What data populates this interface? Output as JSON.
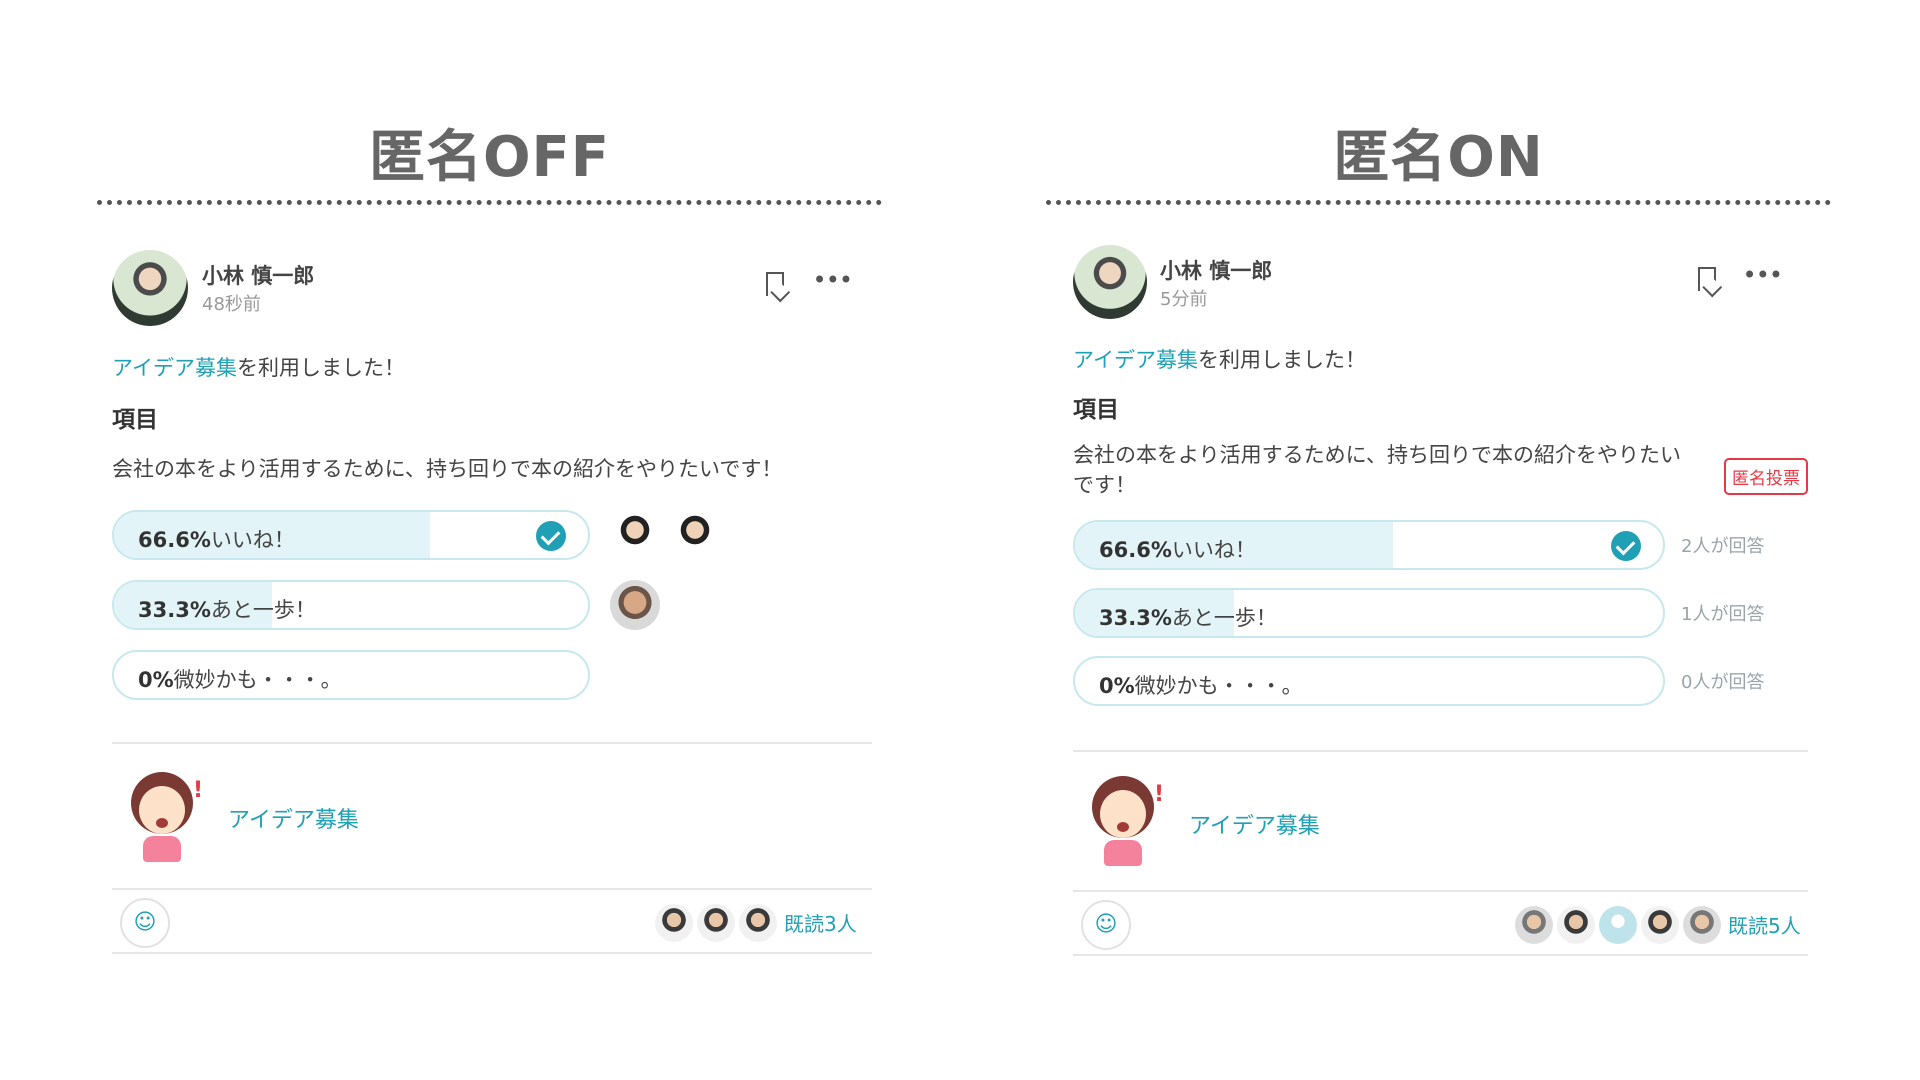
{
  "panels": [
    {
      "title": "匿名OFF",
      "author": "小林 慎一郎",
      "time": "48秒前",
      "used_link": "アイデア募集",
      "used_suffix": "を利用しました！",
      "section_label": "項目",
      "question": "会社の本をより活用するために、持ち回りで本の紹介をやりたいです！",
      "options": [
        {
          "pct": "66.6%",
          "label": "いいね！",
          "value": 66.6,
          "checked": true
        },
        {
          "pct": "33.3%",
          "label": "あと一歩！",
          "value": 33.3,
          "checked": false
        },
        {
          "pct": "0%",
          "label": "微妙かも・・・。",
          "value": 0,
          "checked": false
        }
      ],
      "feature_link": "アイデア募集",
      "read_count": "既読3人"
    },
    {
      "title": "匿名ON",
      "author": "小林 慎一郎",
      "time": "5分前",
      "used_link": "アイデア募集",
      "used_suffix": "を利用しました！",
      "section_label": "項目",
      "question": "会社の本をより活用するために、持ち回りで本の紹介をやりたいです！",
      "anon_badge": "匿名投票",
      "options": [
        {
          "pct": "66.6%",
          "label": "いいね！",
          "value": 66.6,
          "checked": true,
          "answered": "2人が回答"
        },
        {
          "pct": "33.3%",
          "label": "あと一歩！",
          "value": 33.3,
          "checked": false,
          "answered": "1人が回答"
        },
        {
          "pct": "0%",
          "label": "微妙かも・・・。",
          "value": 0,
          "checked": false,
          "answered": "0人が回答"
        }
      ],
      "feature_link": "アイデア募集",
      "read_count": "既読5人"
    }
  ],
  "icons": {
    "bookmark": "bookmark-icon",
    "more": "more-icon",
    "check": "check-circle-icon",
    "emoji": "add-reaction-icon"
  },
  "colors": {
    "accent": "#1fa0b4",
    "badge": "#e63946",
    "bar_fill": "#e3f4f8"
  }
}
